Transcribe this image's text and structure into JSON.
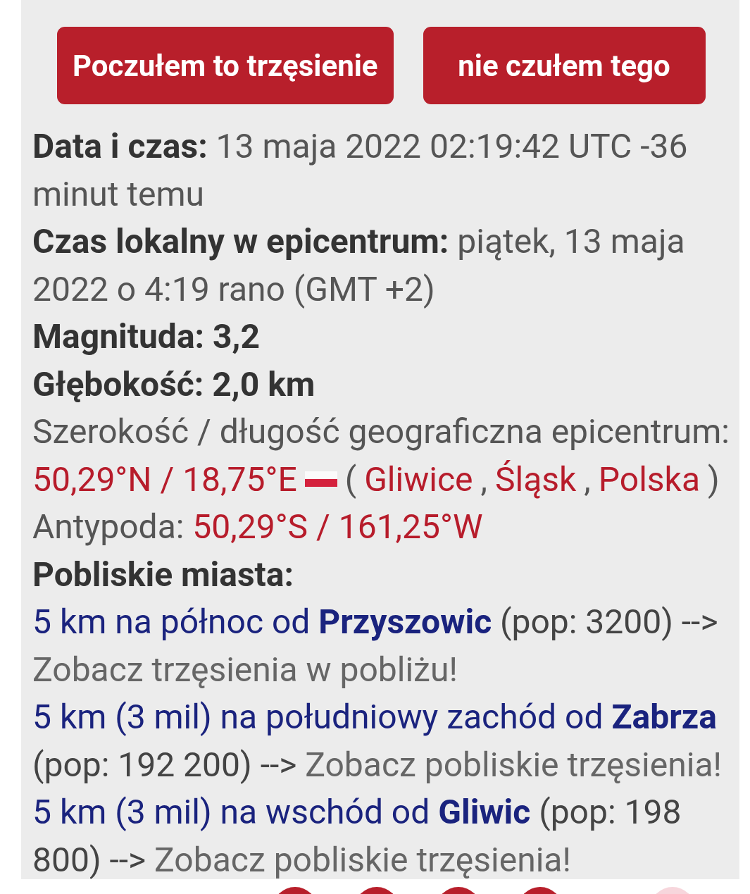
{
  "buttons": [
    "Poczułem to trzęsienie",
    "nie czułem tego"
  ],
  "date": {
    "label": "Data i czas:",
    "value": "13 maja 2022 02:19:42 UTC -36 minut temu"
  },
  "local_time": {
    "label": "Czas lokalny w epicentrum:",
    "value": "piątek, 13 maja 2022 o 4:19 rano (GMT +2)"
  },
  "magnitude": "Magnituda: 3,2",
  "depth": "Głębokość: 2,0 km",
  "coordinates": {
    "label": "Szerokość / długość geograficzna epicentrum:",
    "value": "50,29°N / 18,75°E",
    "open": "(",
    "separator": ",",
    "close": ")",
    "places": [
      "Gliwice",
      "Śląsk",
      "Polska"
    ]
  },
  "antipode": {
    "label": "Antypoda:",
    "value": "50,29°S / 161,25°W"
  },
  "nearby_title": "Pobliskie miasta:",
  "nearby_cities": [
    {
      "distance": "5 km na północ od **Przyszowic**",
      "population": "(pop: 3200) -->",
      "link": "Zobacz trzęsienia w pobliżu!"
    },
    {
      "distance": "5 km (3 mil) na południowy zachód od **Zabrza**",
      "population": "(pop: 192 200) -->",
      "link": "Zobacz pobliskie trzęsienia!"
    },
    {
      "distance": "5 km (3 mil) na wschód od **Gliwic**",
      "population": "(pop: 198 800) -->",
      "link": "Zobacz pobliskie trzęsienia!"
    }
  ]
}
